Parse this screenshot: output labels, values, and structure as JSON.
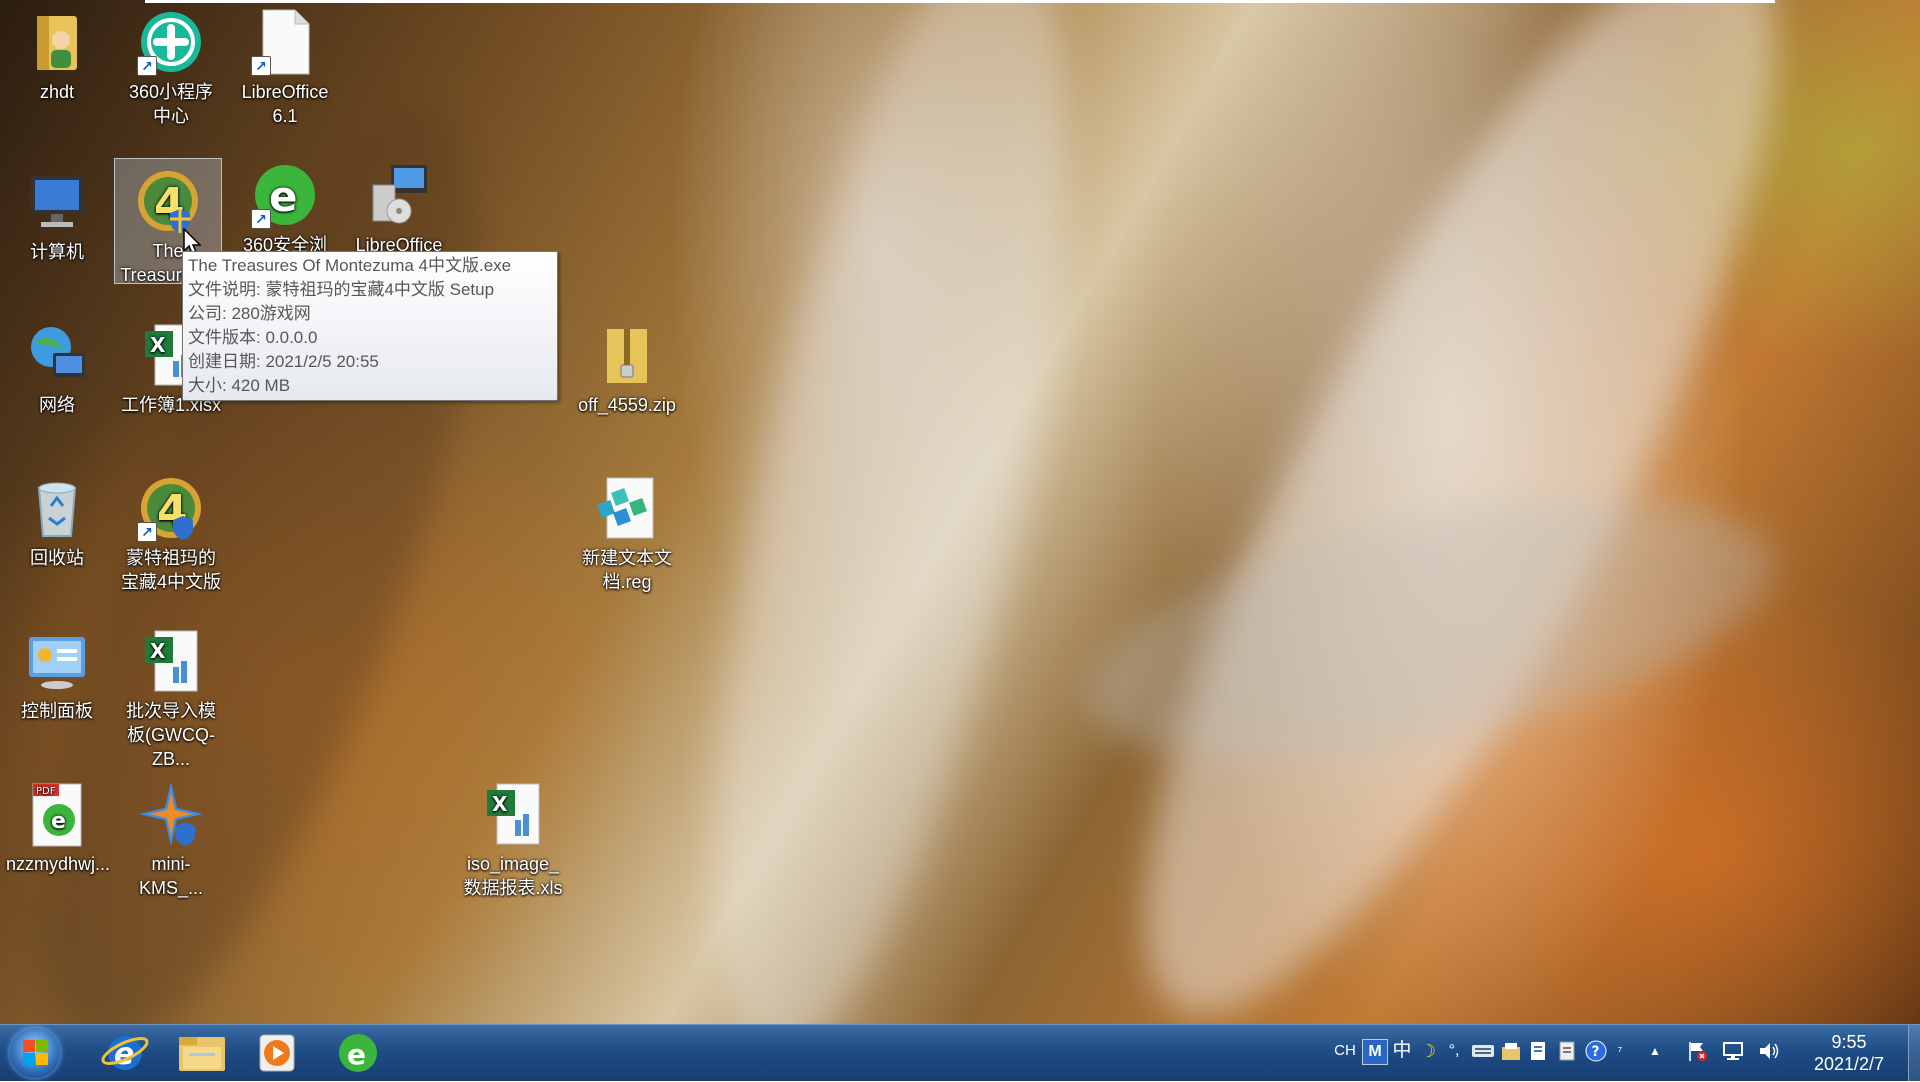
{
  "desktop": {
    "icons": {
      "zhdt": "zhdt",
      "mini360": "360小程序中心",
      "libreoffice61": "LibreOffice 6.1",
      "computer": "计算机",
      "treasures": "The Treasures...",
      "browser360": "360安全浏览器",
      "libreofficeapp": "LibreOffice",
      "network": "网络",
      "workbook": "工作簿1.xlsx",
      "zip": "off_4559.zip",
      "recycle": "回收站",
      "montezuma": "蒙特祖玛的宝藏4中文版",
      "reg": "新建文本文档.reg",
      "control": "控制面板",
      "batch": "批次导入模板(GWCQ-ZB...",
      "nzz": "nzzmydhwj...",
      "kms": "mini-KMS_...",
      "iso": "iso_image_数据报表.xls"
    }
  },
  "tooltip": {
    "line1": "The Treasures Of Montezuma 4中文版.exe",
    "line2": "文件说明: 蒙特祖玛的宝藏4中文版 Setup",
    "line3": "公司: 280游戏网",
    "line4": "文件版本: 0.0.0.0",
    "line5": "创建日期: 2021/2/5 20:55",
    "line6": "大小: 420 MB"
  },
  "taskbar": {
    "tray": {
      "lang": "CH",
      "ime_m": "M",
      "ime_zh": "中",
      "punct": "°,"
    },
    "clock": {
      "time": "9:55",
      "date": "2021/2/7"
    }
  },
  "colors": {
    "taskbar": "#1f4d86",
    "tooltip_border": "#767676",
    "excel_green": "#1e7b3a",
    "ie_blue": "#1a6fd1",
    "browser_green": "#3cb53c"
  }
}
